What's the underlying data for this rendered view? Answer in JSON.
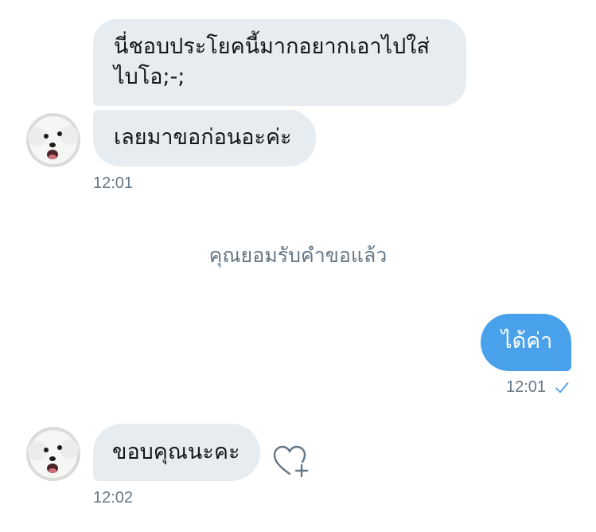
{
  "conversation": {
    "messages": [
      {
        "direction": "incoming",
        "lines": [
          "นี่ชอบประโยคนี้มากอยากเอาไปใส่",
          "ไบโอ;-;"
        ]
      },
      {
        "direction": "incoming",
        "text": "เลยมาขอก่อนอะค่ะ",
        "time": "12:01"
      },
      {
        "direction": "outgoing",
        "text": "ได้ค่า",
        "time": "12:01",
        "status": "read-check"
      },
      {
        "direction": "incoming",
        "text": "ขอบคุณนะคะ",
        "time": "12:02"
      }
    ],
    "system_notice": "คุณยอมรับคำขอแล้ว"
  },
  "icons": {
    "avatar": "white-dog-avatar",
    "check": "check-icon",
    "like": "heart-plus-icon"
  },
  "colors": {
    "incoming_bubble": "#e6ecf0",
    "outgoing_bubble": "#4aa1eb",
    "timestamp": "#657786",
    "accent": "#1da1f2"
  }
}
